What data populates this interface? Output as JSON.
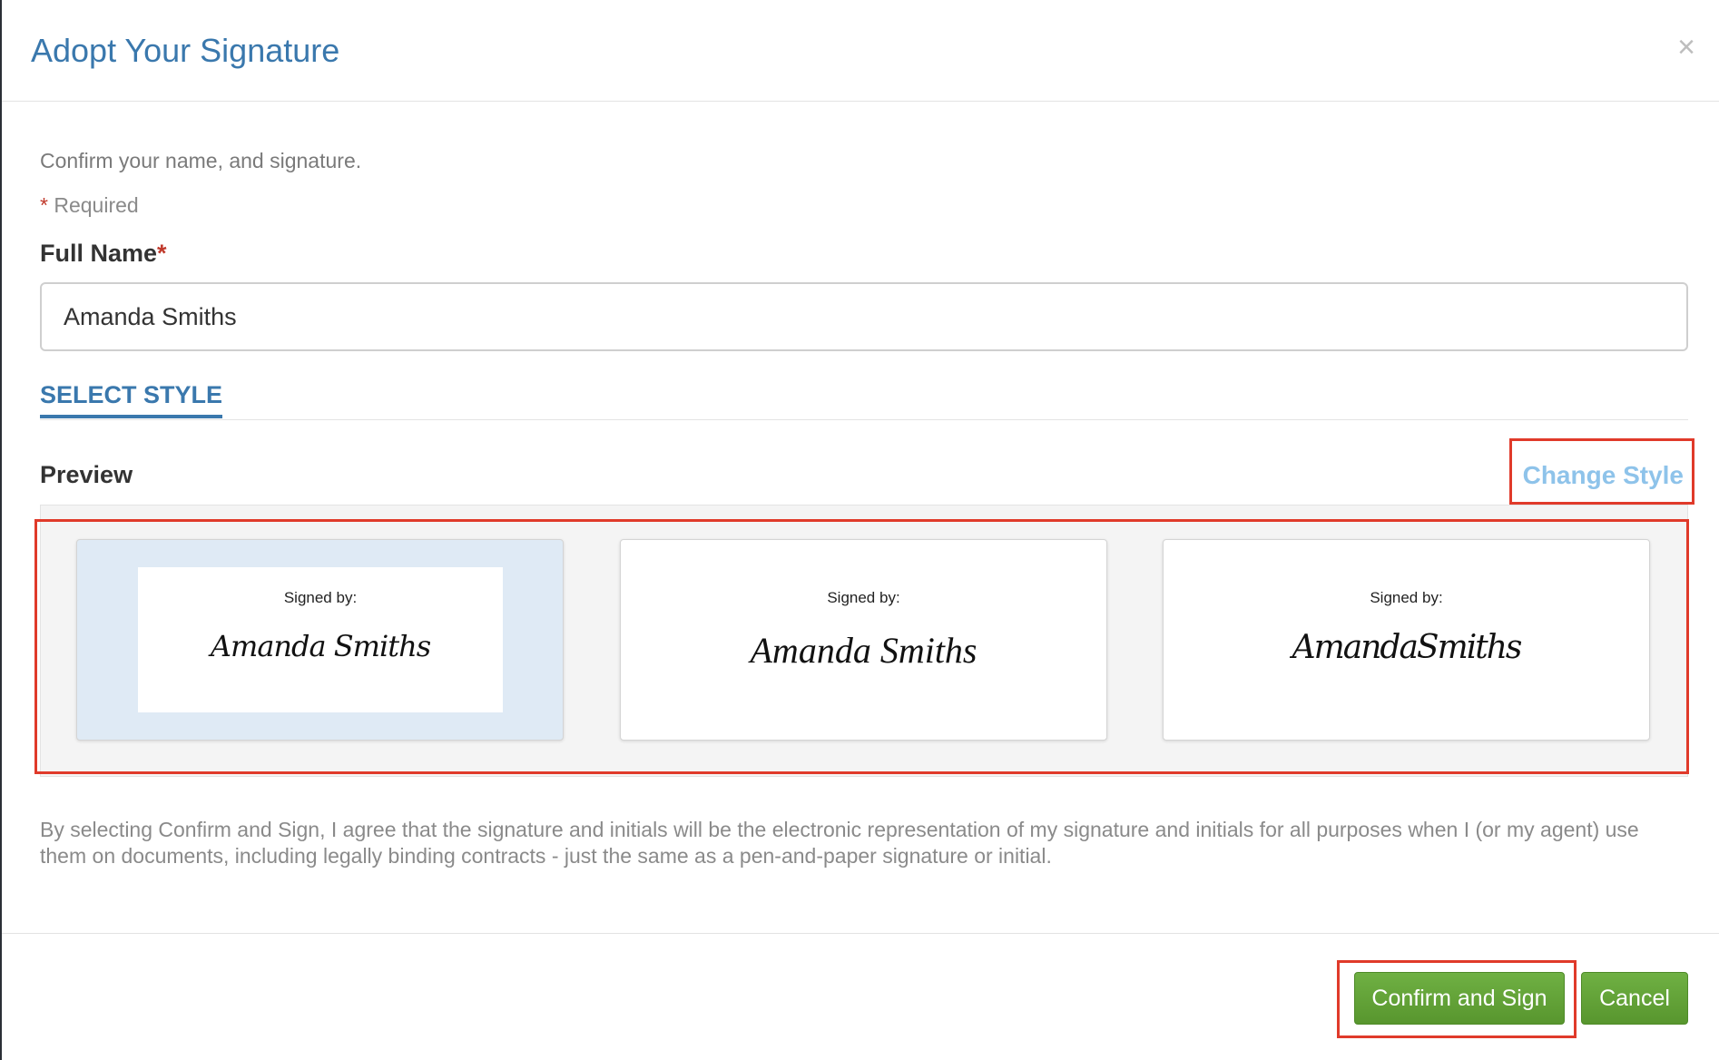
{
  "dialog": {
    "title": "Adopt Your Signature",
    "close_glyph": "×"
  },
  "form": {
    "intro": "Confirm your name, and signature.",
    "required_star": "*",
    "required_label": "Required",
    "full_name_label": "Full Name",
    "full_name_star": "*",
    "full_name_value": "Amanda Smiths"
  },
  "tabs": {
    "select_style": "SELECT STYLE"
  },
  "preview": {
    "label": "Preview",
    "change_style": "Change Style",
    "styles": [
      {
        "signed_by": "Signed by:",
        "signature": "Amanda Smiths",
        "selected": true
      },
      {
        "signed_by": "Signed by:",
        "signature": "Amanda Smiths",
        "selected": false
      },
      {
        "signed_by": "Signed by:",
        "signature": "AmandaSmiths",
        "selected": false
      }
    ]
  },
  "agreement": "By selecting Confirm and Sign, I agree that the signature and initials will be the electronic representation of my signature and initials for all purposes when I (or my agent) use them on documents, including legally binding contracts - just the same as a pen-and-paper signature or initial.",
  "footer": {
    "confirm_label": "Confirm and Sign",
    "cancel_label": "Cancel"
  },
  "colors": {
    "title_blue": "#3a78ad",
    "link_light_blue": "#8ec3ea",
    "button_green": "#5fa136",
    "highlight_red": "#e03a2a",
    "selected_card_bg": "#dfeaf5"
  }
}
